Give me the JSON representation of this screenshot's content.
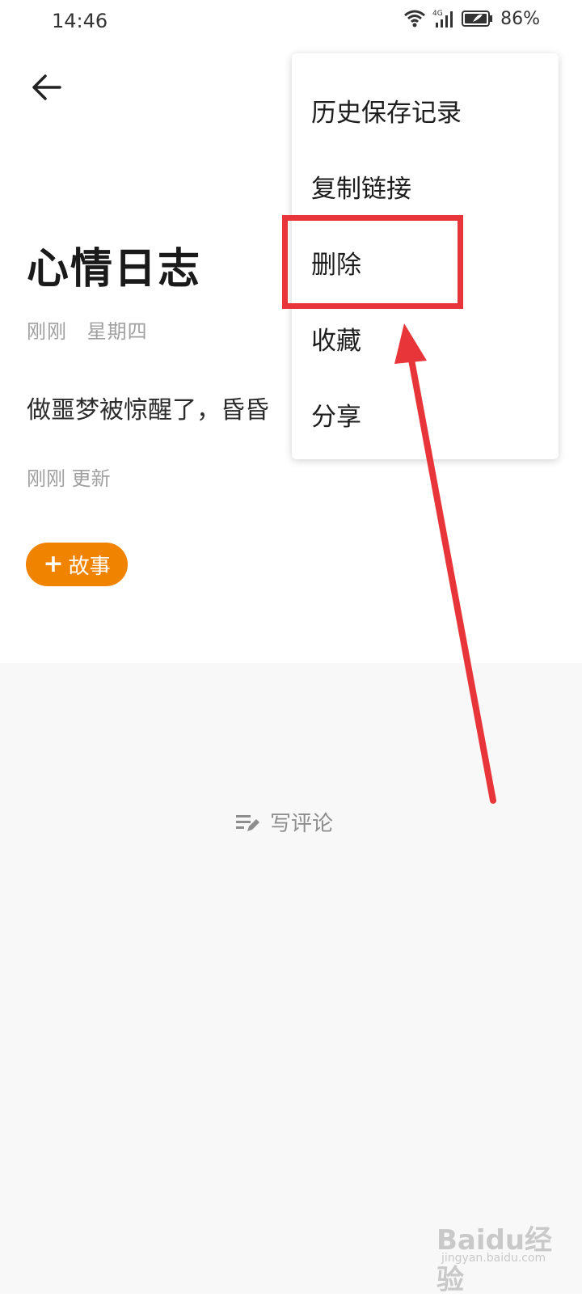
{
  "status_bar": {
    "time": "14:46",
    "battery": "86%",
    "network": "4G"
  },
  "page": {
    "title": "心情日志",
    "meta_time": "刚刚",
    "meta_day": "星期四",
    "content": "做噩梦被惊醒了，昏昏",
    "updated": "刚刚 更新",
    "story_button": "故事",
    "comment_label": "写评论"
  },
  "menu": {
    "items": [
      "历史保存记录",
      "复制链接",
      "删除",
      "收藏",
      "分享"
    ]
  },
  "colors": {
    "accent": "#f08300",
    "highlight": "#e8353a"
  },
  "watermark": {
    "brand": "Baidu经验",
    "url": "jingyan.baidu.com"
  }
}
